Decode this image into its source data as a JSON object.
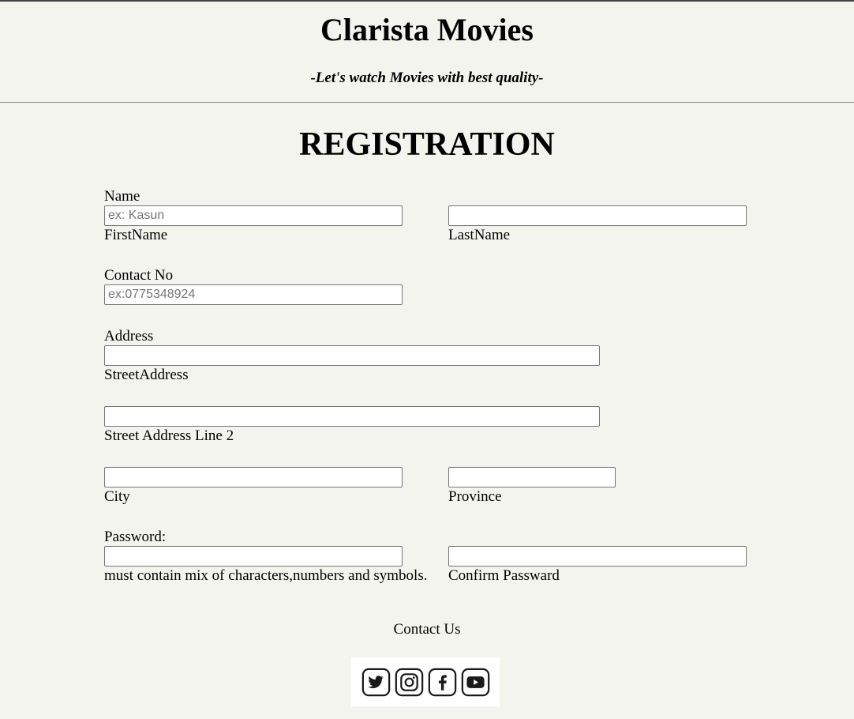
{
  "header": {
    "site_title": "Clarista Movies",
    "tagline": "-Let's watch Movies with best quality-"
  },
  "page_title": "REGISTRATION",
  "form": {
    "name": {
      "label": "Name",
      "first_placeholder": "ex: Kasun",
      "first_caption": "FirstName",
      "last_placeholder": "",
      "last_caption": "LastName"
    },
    "contact": {
      "label": "Contact No",
      "placeholder": "ex:0775348924"
    },
    "address": {
      "label": "Address",
      "street_caption": "StreetAddress",
      "street2_caption": "Street Address Line 2",
      "city_caption": "City",
      "province_caption": "Province"
    },
    "password": {
      "label": "Password:",
      "hint": "must contain mix of characters,numbers and symbols.",
      "confirm_caption": "Confirm Passward"
    }
  },
  "footer": {
    "contact_label": "Contact Us",
    "social": [
      {
        "icon": "twitter-icon"
      },
      {
        "icon": "instagram-icon"
      },
      {
        "icon": "facebook-icon"
      },
      {
        "icon": "youtube-icon"
      }
    ]
  }
}
